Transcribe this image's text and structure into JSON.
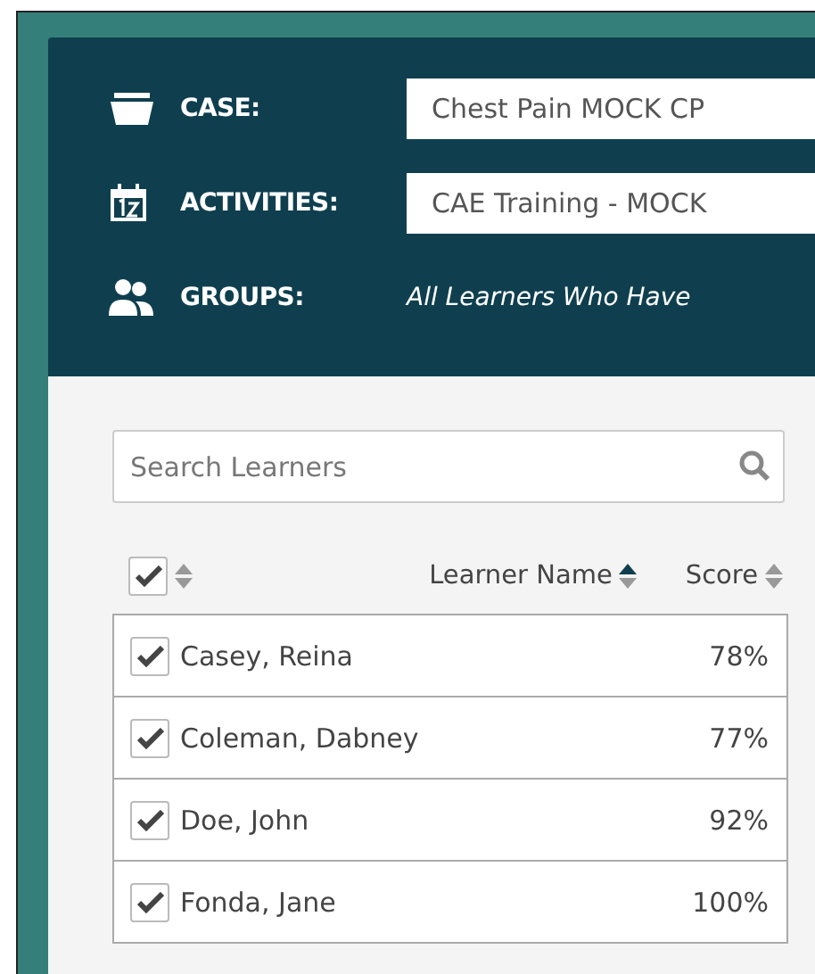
{
  "filters": [
    {
      "kind": "dropdown",
      "label": "CASE:",
      "value": "Chest Pain MOCK CP"
    },
    {
      "kind": "dropdown",
      "label": "ACTIVITIES:",
      "value": "CAE Training - MOCK"
    },
    {
      "kind": "text",
      "label": "GROUPS:",
      "value": "All Learners Who Have"
    }
  ],
  "search": {
    "placeholder": "Search Learners"
  },
  "table": {
    "select_all": {
      "checked": true
    },
    "columns": [
      {
        "label": "Learner Name",
        "sorted": true
      },
      {
        "label": "Score",
        "sorted": false
      }
    ],
    "rows": [
      {
        "name": "Casey, Reina",
        "score": "78%",
        "checked": true
      },
      {
        "name": "Coleman, Dabney",
        "score": "77%",
        "checked": true
      },
      {
        "name": "Doe, John",
        "score": "92%",
        "checked": true
      },
      {
        "name": "Fonda, Jane",
        "score": "100%",
        "checked": true
      }
    ]
  }
}
